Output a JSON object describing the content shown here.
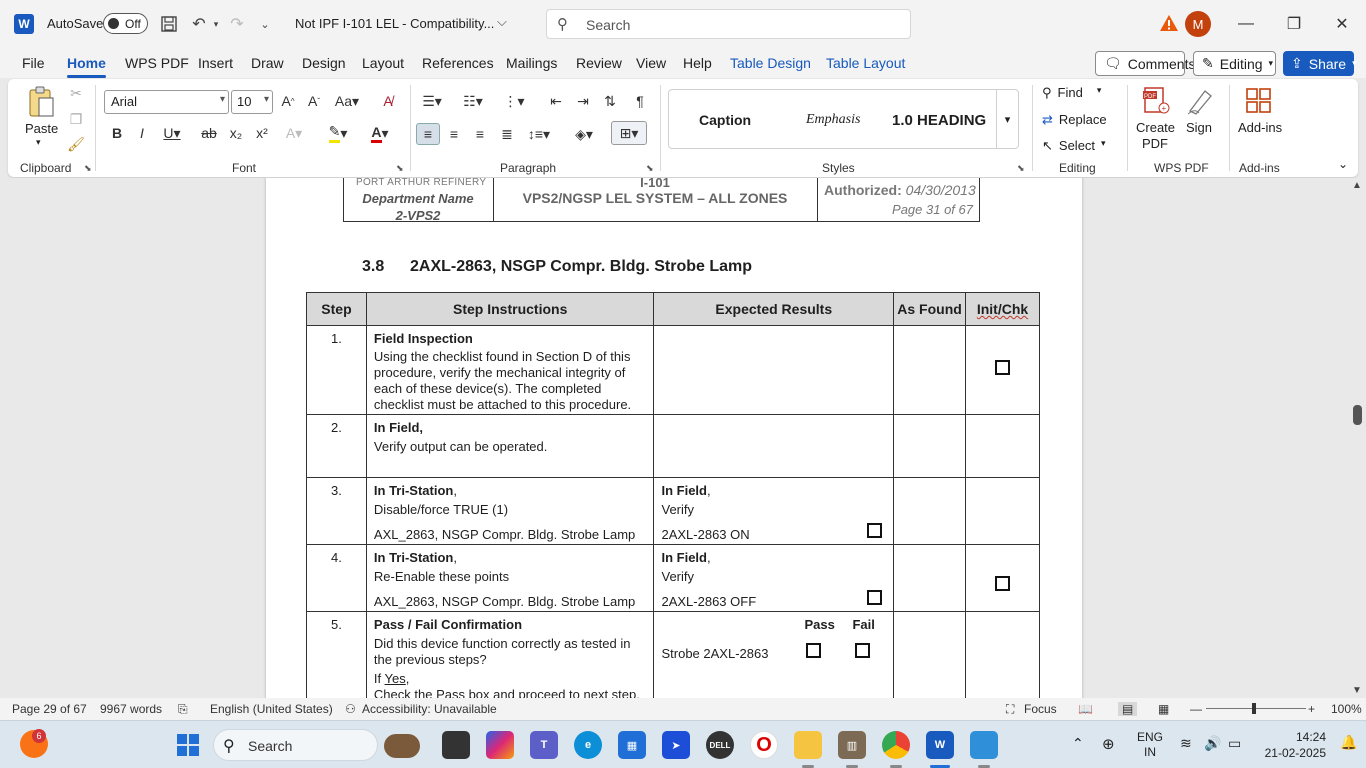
{
  "titlebar": {
    "app_logo": "W",
    "autosave_label": "AutoSave",
    "autosave_state": "Off",
    "doc_title": "Not IPF I-101 LEL  -  Compatibility...",
    "search_placeholder": "Search",
    "avatar_initial": "M"
  },
  "ribbon_tabs": [
    "File",
    "Home",
    "WPS PDF",
    "Insert",
    "Draw",
    "Design",
    "Layout",
    "References",
    "Mailings",
    "Review",
    "View",
    "Help",
    "Table Design",
    "Table Layout"
  ],
  "active_tab": "Home",
  "right_buttons": {
    "comments": "Comments",
    "editing": "Editing",
    "share": "Share"
  },
  "ribbon": {
    "clipboard": {
      "paste_label": "Paste",
      "group": "Clipboard"
    },
    "font": {
      "family": "Arial",
      "size": "10",
      "group": "Font"
    },
    "paragraph": {
      "group": "Paragraph"
    },
    "styles": {
      "items": [
        "Caption",
        "Emphasis",
        "1.0  HEADING"
      ],
      "group": "Styles"
    },
    "editing": {
      "find": "Find",
      "replace": "Replace",
      "select": "Select",
      "group": "Editing"
    },
    "wps_pdf": {
      "create": "Create PDF",
      "sign": "Sign",
      "group": "WPS PDF"
    },
    "addins": {
      "label": "Add-ins",
      "group": "Add-ins"
    }
  },
  "doc_header": {
    "refinery": "PORT ARTHUR REFINERY",
    "department": "Department Name",
    "dept_code": "2-VPS2",
    "procedure_id": "I-101",
    "system": "VPS2/NGSP LEL SYSTEM – ALL ZONES",
    "authorized_label": "Authorized:",
    "authorized_date": "04/30/2013",
    "page_info": "Page 31 of 67"
  },
  "section": {
    "number": "3.8",
    "title": "2AXL-2863, NSGP Compr. Bldg. Strobe Lamp"
  },
  "table": {
    "headers": [
      "Step",
      "Step Instructions",
      "Expected Results",
      "As Found",
      "Init/Chk"
    ],
    "rows": [
      {
        "step": "1.",
        "title": "Field Inspection",
        "body": "Using the checklist found in Section D of this procedure, verify the mechanical integrity of each of these device(s). The completed checklist must be attached to this procedure."
      },
      {
        "step": "2.",
        "title": "In Field,",
        "body": "Verify output can be operated."
      },
      {
        "step": "3.",
        "title": "In Tri-Station",
        "title_suffix": ",",
        "line2": "Disable/force TRUE (1)",
        "line3": "AXL_2863, NSGP Compr. Bldg. Strobe Lamp",
        "exp_title": "In Field",
        "exp_suffix": ",",
        "exp_line2": "Verify",
        "exp_line3": "2AXL-2863 ON"
      },
      {
        "step": "4.",
        "title": "In Tri-Station",
        "title_suffix": ",",
        "line2": "Re-Enable these points",
        "line3": "AXL_2863, NSGP Compr. Bldg. Strobe Lamp",
        "exp_title": "In Field",
        "exp_suffix": ",",
        "exp_line2": "Verify",
        "exp_line3": "2AXL-2863 OFF"
      },
      {
        "step": "5.",
        "title": "Pass / Fail Confirmation",
        "line2": "Did this device function correctly as tested in the previous steps?",
        "line3_prefix": "If ",
        "line3_link": "Yes",
        "line3_suffix": ",",
        "line4": "Check the Pass box and proceed to next step.",
        "pass": "Pass",
        "fail": "Fail",
        "exp_line": "Strobe 2AXL-2863"
      }
    ]
  },
  "statusbar": {
    "page": "Page 29 of 67",
    "words": "9967 words",
    "language": "English (United States)",
    "accessibility": "Accessibility: Unavailable",
    "focus": "Focus",
    "zoom": "100%"
  },
  "taskbar": {
    "search_placeholder": "Search",
    "notification_count": "6",
    "lang_top": "ENG",
    "lang_bottom": "IN",
    "time": "14:24",
    "date": "21-02-2025"
  },
  "colors": {
    "accent": "#185abd",
    "share_bg": "#185abd",
    "avatar": "#c2410c"
  }
}
